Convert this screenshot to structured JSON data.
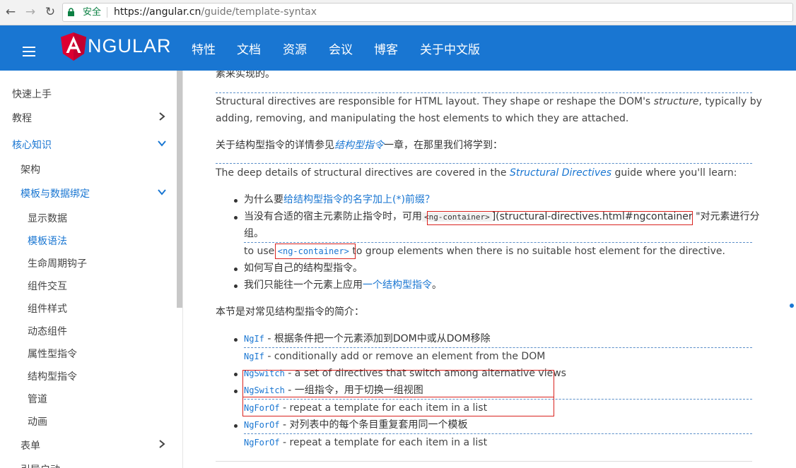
{
  "browser": {
    "secure_label": "安全",
    "url_host": "https://angular.cn",
    "url_path": "/guide/template-syntax"
  },
  "header": {
    "brand": "NGULAR",
    "nav": [
      "特性",
      "文档",
      "资源",
      "会议",
      "博客",
      "关于中文版"
    ]
  },
  "sidebar": {
    "items": [
      "快速上手",
      "教程",
      "核心知识",
      "架构",
      "模板与数据绑定",
      "显示数据",
      "模板语法",
      "生命周期钩子",
      "组件交互",
      "组件样式",
      "动态组件",
      "属性型指令",
      "结构型指令",
      "管道",
      "动画",
      "表单",
      "引导启动"
    ]
  },
  "content": {
    "top_cut": "素来实现的。",
    "para1_a": "Structural directives are responsible for HTML layout. They shape or reshape the DOM's ",
    "para1_it": "structure",
    "para1_b": ", typically by",
    "para1_line2": "adding, removing, and manipulating the host elements to which they are attached.",
    "para2_a": "关于结构型指令的详情参见",
    "para2_link": "结构型指令",
    "para2_b": "一章，在那里我们将学到：",
    "para3_a": "The deep details of structural directives are covered in the ",
    "para3_link": "Structural Directives",
    "para3_b": " guide where you'll learn:",
    "b1_a": "为什么要",
    "b1_link": "给结构型指令的名字加上(*)前缀？",
    "b2_a": "当没有合适的宿主元素防止指令时，可用",
    "b2_code": "<ng-container>",
    "b2_b": "](structural-directives.html#ngcontainer \"对元素进行分",
    "b2_line2": "组。",
    "b2_en_a": "to use ",
    "b2_en_code": "<ng-container>",
    "b2_en_b": " to group elements when there is no suitable host element for the directive.",
    "b3": "如何写自己的结构型指令。",
    "b4_a": "我们只能往一个元素上应用",
    "b4_link": "一个结构型指令",
    "b4_b": "。",
    "intro": "本节是对常见结构型指令的简介：",
    "l1_code": "NgIf",
    "l1_text": " - 根据条件把一个元素添加到DOM中或从DOM移除",
    "l1_en": " - conditionally add or remove an element from the DOM",
    "l2_code": "NgSwitch",
    "l2_en": " - a set of directives that switch among alternative views",
    "l3_code": "NgSwitch",
    "l3_text": " - 一组指令，用于切换一组视图",
    "l3_en_code": "NgForOf",
    "l3_en": " - repeat a template for each item in a list",
    "l4_code": "NgForOf",
    "l4_text": " - 对列表中的每个条目重复套用同一个模板",
    "l4_en_code": "NgForOf",
    "l4_en": " - repeat a template for each item in a list"
  }
}
